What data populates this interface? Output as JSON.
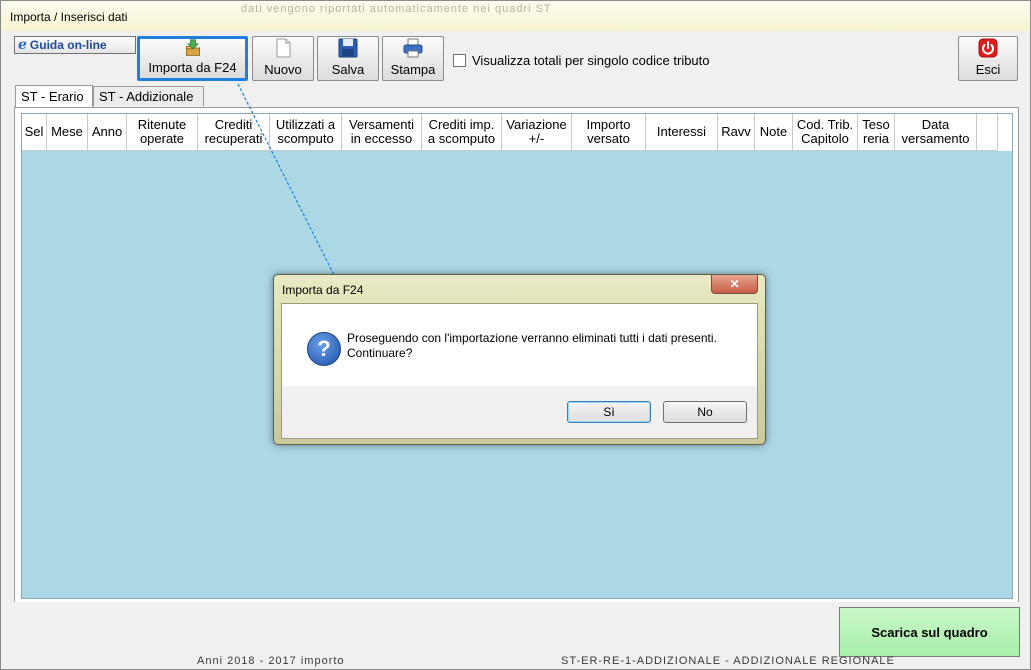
{
  "window": {
    "title": "Importa / Inserisci dati",
    "background_blur_text": "dati vengono riportati automaticamente nei quadri ST"
  },
  "toolbar": {
    "guida_label": "Guida on-line",
    "buttons": [
      {
        "label": "Importa da F24",
        "icon": "import-folder-icon",
        "active": true
      },
      {
        "label": "Nuovo",
        "icon": "new-document-icon"
      },
      {
        "label": "Salva",
        "icon": "floppy-disk-icon"
      },
      {
        "label": "Stampa",
        "icon": "printer-icon"
      }
    ],
    "checkbox_label": "Visualizza totali per singolo codice tributo",
    "checkbox_checked": false,
    "exit_label": "Esci",
    "exit_icon": "power-icon"
  },
  "tabs": [
    {
      "label": "ST - Erario",
      "selected": true
    },
    {
      "label": "ST - Addizionale",
      "selected": false
    }
  ],
  "grid": {
    "columns": [
      {
        "line1": "Sel",
        "line2": ""
      },
      {
        "line1": "Mese",
        "line2": ""
      },
      {
        "line1": "Anno",
        "line2": ""
      },
      {
        "line1": "Ritenute",
        "line2": "operate"
      },
      {
        "line1": "Crediti",
        "line2": "recuperati"
      },
      {
        "line1": "Utilizzati a",
        "line2": "scomputo"
      },
      {
        "line1": "Versamenti",
        "line2": "in eccesso"
      },
      {
        "line1": "Crediti imp.",
        "line2": "a scomputo"
      },
      {
        "line1": "Variazione",
        "line2": "+/-"
      },
      {
        "line1": "Importo",
        "line2": "versato"
      },
      {
        "line1": "Interessi",
        "line2": ""
      },
      {
        "line1": "Ravv",
        "line2": ""
      },
      {
        "line1": "Note",
        "line2": ""
      },
      {
        "line1": "Cod. Trib.",
        "line2": "Capitolo"
      },
      {
        "line1": "Teso",
        "line2": "reria"
      },
      {
        "line1": "Data",
        "line2": "versamento"
      },
      {
        "line1": "",
        "line2": ""
      }
    ],
    "rows": []
  },
  "footer": {
    "scarica_label": "Scarica sul quadro",
    "behind_text_left": "Anni 2018 - 2017 importo",
    "behind_text_right": "ST-ER-RE-1-ADDIZIONALE - ADDIZIONALE REGIONALE"
  },
  "dialog": {
    "title": "Importa da F24",
    "close_glyph": "✕",
    "message_line1": "Proseguendo con l'importazione verranno eliminati tutti i dati presenti.",
    "message_line2": "Continuare?",
    "icon": "question-icon",
    "yes_label": "Sì",
    "no_label": "No"
  },
  "colors": {
    "grid_background": "#acd8e6",
    "active_button_border": "#1e7fe0",
    "scarica_background": "#b8f3b9",
    "exit_icon": "#e21b1b"
  }
}
